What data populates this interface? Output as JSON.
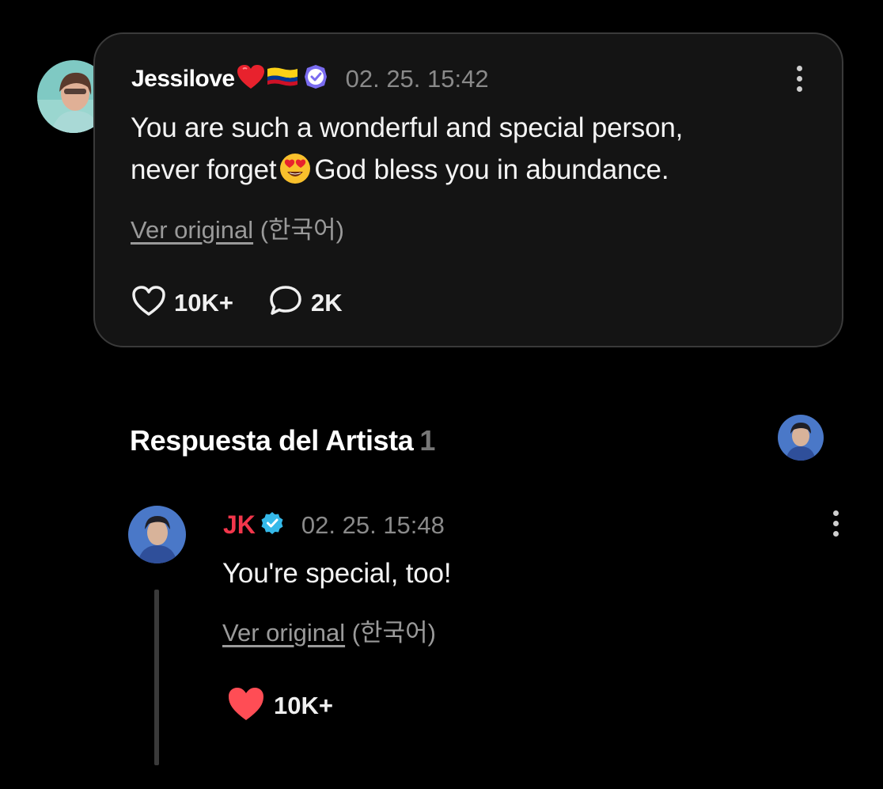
{
  "comment": {
    "username": "Jessilove",
    "timestamp": "02. 25. 15:42",
    "text_line1": "You are such a wonderful and special person,",
    "text_line2a": "never forget",
    "text_line2b": "God bless you in abundance.",
    "translate_link": "Ver original",
    "translate_lang": "(한국어)",
    "likes": "10K+",
    "replies": "2K",
    "colors": {
      "card_bg": "#141414",
      "card_border": "#3a3a3a"
    }
  },
  "artist_reply_section": {
    "title": "Respuesta del Artista",
    "count": "1"
  },
  "reply": {
    "username": "JK",
    "timestamp": "02. 25. 15:48",
    "text": "You're special, too!",
    "translate_link": "Ver original",
    "translate_lang": "(한국어)",
    "likes": "10K+",
    "colors": {
      "username": "#f2364b",
      "liked_heart": "#ff4d55",
      "verified_badge": "#35b9e9"
    }
  },
  "icons": {
    "heart_outline": "heart-outline-icon",
    "speech_bubble": "comment-bubble-icon",
    "heart_filled": "heart-filled-icon",
    "kebab": "more-vertical-icon",
    "verified": "verified-badge-icon",
    "fan_badge": "fan-badge-icon"
  }
}
